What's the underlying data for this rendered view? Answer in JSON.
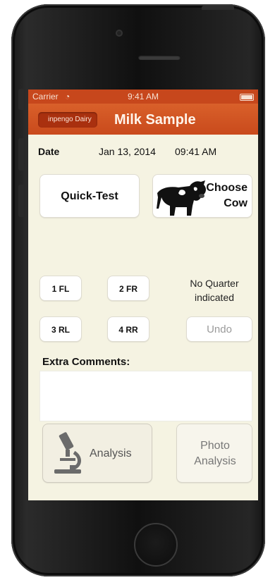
{
  "status_bar": {
    "carrier": "Carrier",
    "wifi_icon": "◔",
    "time": "9:41 AM"
  },
  "nav": {
    "back_label": "inpengo Dairy",
    "title": "Milk Sample"
  },
  "date_row": {
    "label": "Date",
    "date": "Jan 13, 2014",
    "time": "09:41 AM"
  },
  "buttons": {
    "quick_test": "Quick-Test",
    "choose_cow_line1": "Choose",
    "choose_cow_line2": "Cow",
    "q1": "1 FL",
    "q2": "2 FR",
    "q3": "3 RL",
    "q4": "4 RR",
    "undo": "Undo",
    "analysis": "Analysis",
    "photo_line1": "Photo",
    "photo_line2": "Analysis"
  },
  "quarter_status": {
    "line1": "No Quarter",
    "line2": "indicated"
  },
  "comments": {
    "label": "Extra Comments:",
    "value": ""
  },
  "colors": {
    "nav_orange": "#c94a1c",
    "back_button": "#a9300f",
    "background": "#f5f3e2"
  },
  "icons": {
    "cow": "cow-icon",
    "microscope": "microscope-icon"
  }
}
